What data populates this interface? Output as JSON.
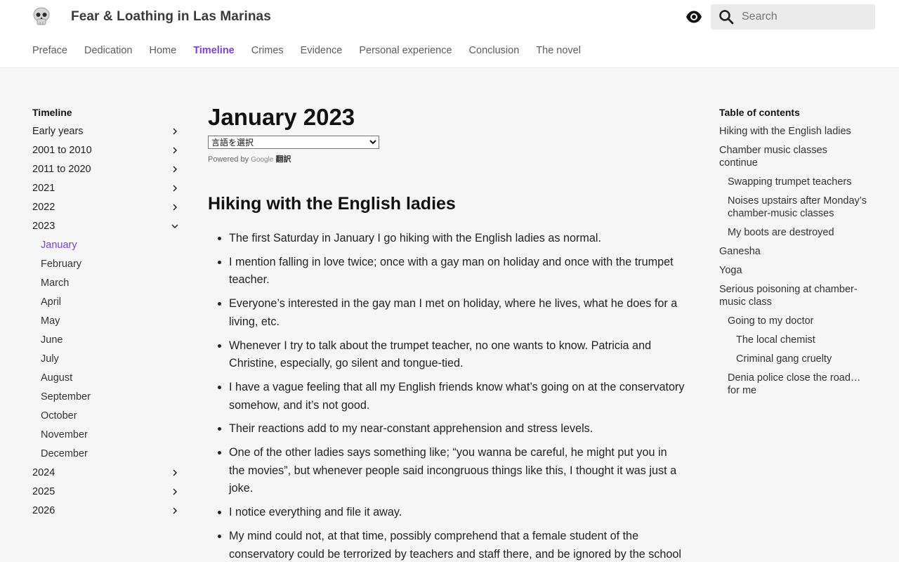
{
  "header": {
    "site_title": "Fear & Loathing in Las Marinas",
    "search_placeholder": "Search"
  },
  "nav": [
    {
      "label": "Preface",
      "active": false
    },
    {
      "label": "Dedication",
      "active": false
    },
    {
      "label": "Home",
      "active": false
    },
    {
      "label": "Timeline",
      "active": true
    },
    {
      "label": "Crimes",
      "active": false
    },
    {
      "label": "Evidence",
      "active": false
    },
    {
      "label": "Personal experience",
      "active": false
    },
    {
      "label": "Conclusion",
      "active": false
    },
    {
      "label": "The novel",
      "active": false
    }
  ],
  "sidebar": {
    "title": "Timeline",
    "items": [
      {
        "label": "Early years"
      },
      {
        "label": "2001 to 2010"
      },
      {
        "label": "2011 to 2020"
      },
      {
        "label": "2021"
      },
      {
        "label": "2022"
      },
      {
        "label": "2023",
        "expanded": true
      },
      {
        "label": "2024"
      },
      {
        "label": "2025"
      },
      {
        "label": "2026"
      }
    ],
    "months": [
      "January",
      "February",
      "March",
      "April",
      "May",
      "June",
      "July",
      "August",
      "September",
      "October",
      "November",
      "December"
    ],
    "active_month": "January"
  },
  "main": {
    "title": "January 2023",
    "language_select": "言語を選択",
    "powered_by": "Powered by",
    "google": "Google",
    "translate": "翻訳",
    "section_title": "Hiking with the English ladies",
    "bullets": [
      "The first Saturday in January I go hiking with the English ladies as normal.",
      "I mention falling in love twice; once with a gay man on holiday and once with the trumpet teacher.",
      "Everyone’s interested in the gay man I met on holiday, where he lives, what he does for a living, etc.",
      "Whenever I try to talk about the trumpet teacher, no one wants to know. Patricia and Christine, especially, go silent and tongue-tied.",
      "I have a vague feeling that all my English friends know what’s going on at the conservatory somehow, and it’s not good.",
      "Their reactions add to my near-constant apprehension and stress levels.",
      "One of the other ladies says something like; “you wanna be careful, he might put you in the movies”, but whenever people said incongruous things like this, I thought it was just a joke.",
      "I notice everything and file it away.",
      "My mind could not, at that time, possibly comprehend that a female student of the conservatory could be terrorized by teachers and staff there, and be ignored by the school board and police when trying to get help."
    ]
  },
  "toc": {
    "title": "Table of contents",
    "items": [
      {
        "label": "Hiking with the English ladies",
        "level": 1
      },
      {
        "label": "Chamber music classes continue",
        "level": 1
      },
      {
        "label": "Swapping trumpet teachers",
        "level": 2
      },
      {
        "label": "Noises upstairs after Monday’s chamber-music classes",
        "level": 2
      },
      {
        "label": "My boots are destroyed",
        "level": 2
      },
      {
        "label": "Ganesha",
        "level": 1
      },
      {
        "label": "Yoga",
        "level": 1
      },
      {
        "label": "Serious poisoning at chamber-music class",
        "level": 1
      },
      {
        "label": "Going to my doctor",
        "level": 2
      },
      {
        "label": "The local chemist",
        "level": 3
      },
      {
        "label": "Criminal gang cruelty",
        "level": 3
      },
      {
        "label": "Denia police close the road… for me",
        "level": 2
      }
    ]
  },
  "colors": {
    "accent": "#7e3fd4",
    "background": "#f6f6f6",
    "header_background": "#ffffff",
    "search_background": "#ebebeb"
  }
}
